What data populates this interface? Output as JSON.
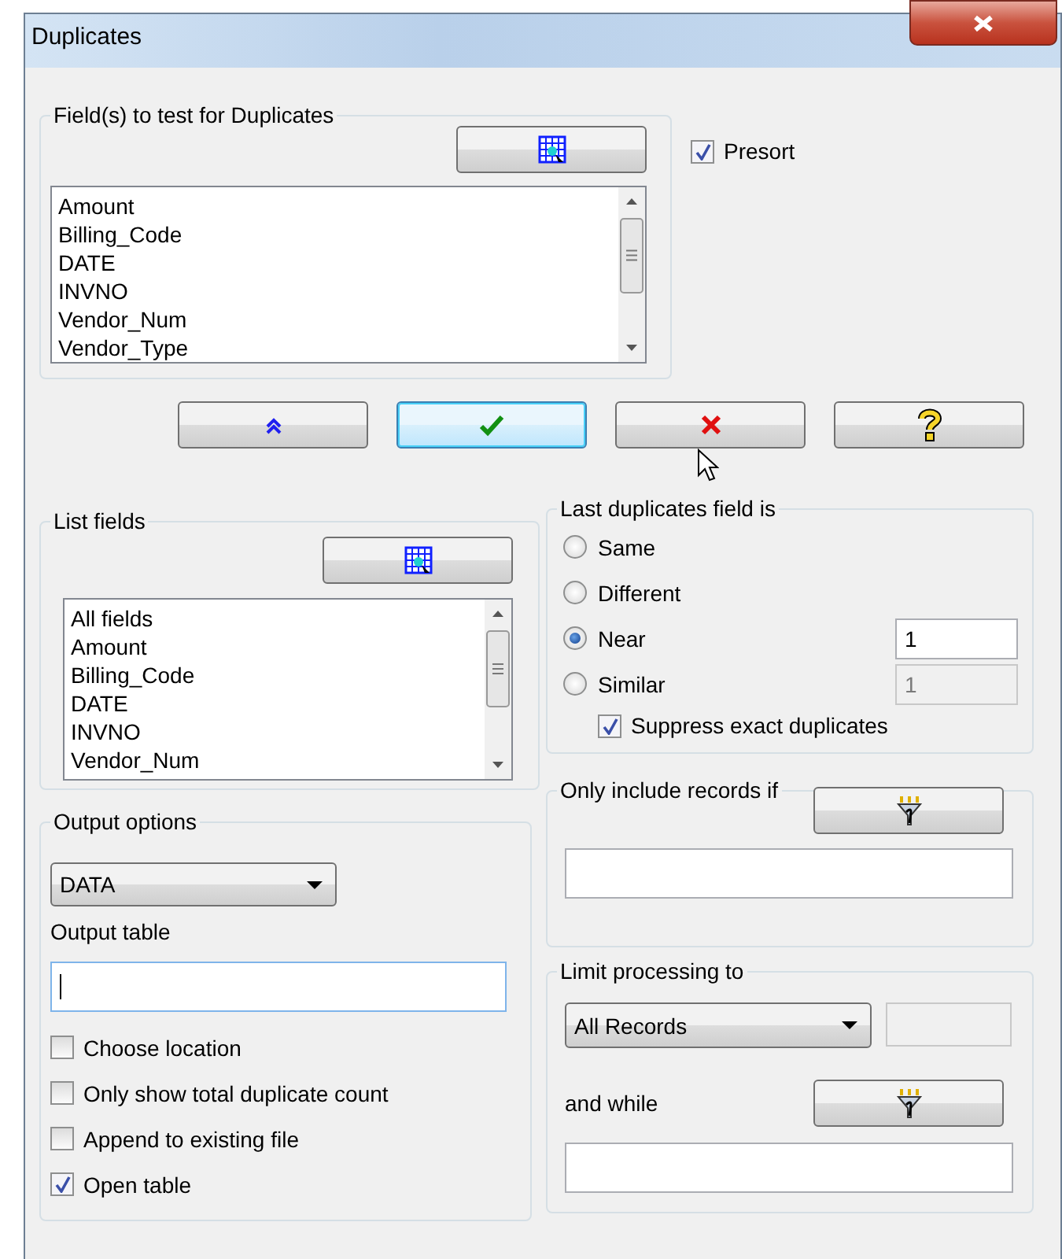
{
  "window": {
    "title": "Duplicates"
  },
  "test_fields": {
    "label": "Field(s) to test for Duplicates",
    "items": [
      "Amount",
      "Billing_Code",
      "DATE",
      "INVNO",
      "Vendor_Num",
      "Vendor_Type"
    ]
  },
  "presort": {
    "label": "Presort",
    "checked": true
  },
  "buttons": [
    {
      "kind": "up",
      "default": false
    },
    {
      "kind": "ok",
      "default": true
    },
    {
      "kind": "cancel",
      "default": false
    },
    {
      "kind": "help",
      "default": false
    }
  ],
  "list_fields": {
    "label": "List fields",
    "items": [
      "All fields",
      "Amount",
      "Billing_Code",
      "DATE",
      "INVNO",
      "Vendor_Num"
    ]
  },
  "last_duplicates": {
    "label": "Last duplicates field is",
    "options": [
      {
        "label": "Same",
        "selected": false
      },
      {
        "label": "Different",
        "selected": false
      },
      {
        "label": "Near",
        "selected": true,
        "field": {
          "value": "1",
          "disabled": false
        }
      },
      {
        "label": "Similar",
        "selected": false,
        "field": {
          "value": "1",
          "disabled": true
        }
      }
    ],
    "suppress": {
      "label": "Suppress exact duplicates",
      "checked": true
    }
  },
  "output_options": {
    "label": "Output options",
    "format": "DATA",
    "table_label": "Output table",
    "table_focused": true,
    "checks": [
      {
        "label": "Choose location",
        "checked": false
      },
      {
        "label": "Only show total duplicate count",
        "checked": false
      },
      {
        "label": "Append to existing file",
        "checked": false
      },
      {
        "label": "Open table",
        "checked": true
      }
    ]
  },
  "only_include": {
    "label": "Only include records if"
  },
  "limit": {
    "label": "Limit processing to",
    "scope": "All Records",
    "and_while_label": "and while"
  }
}
